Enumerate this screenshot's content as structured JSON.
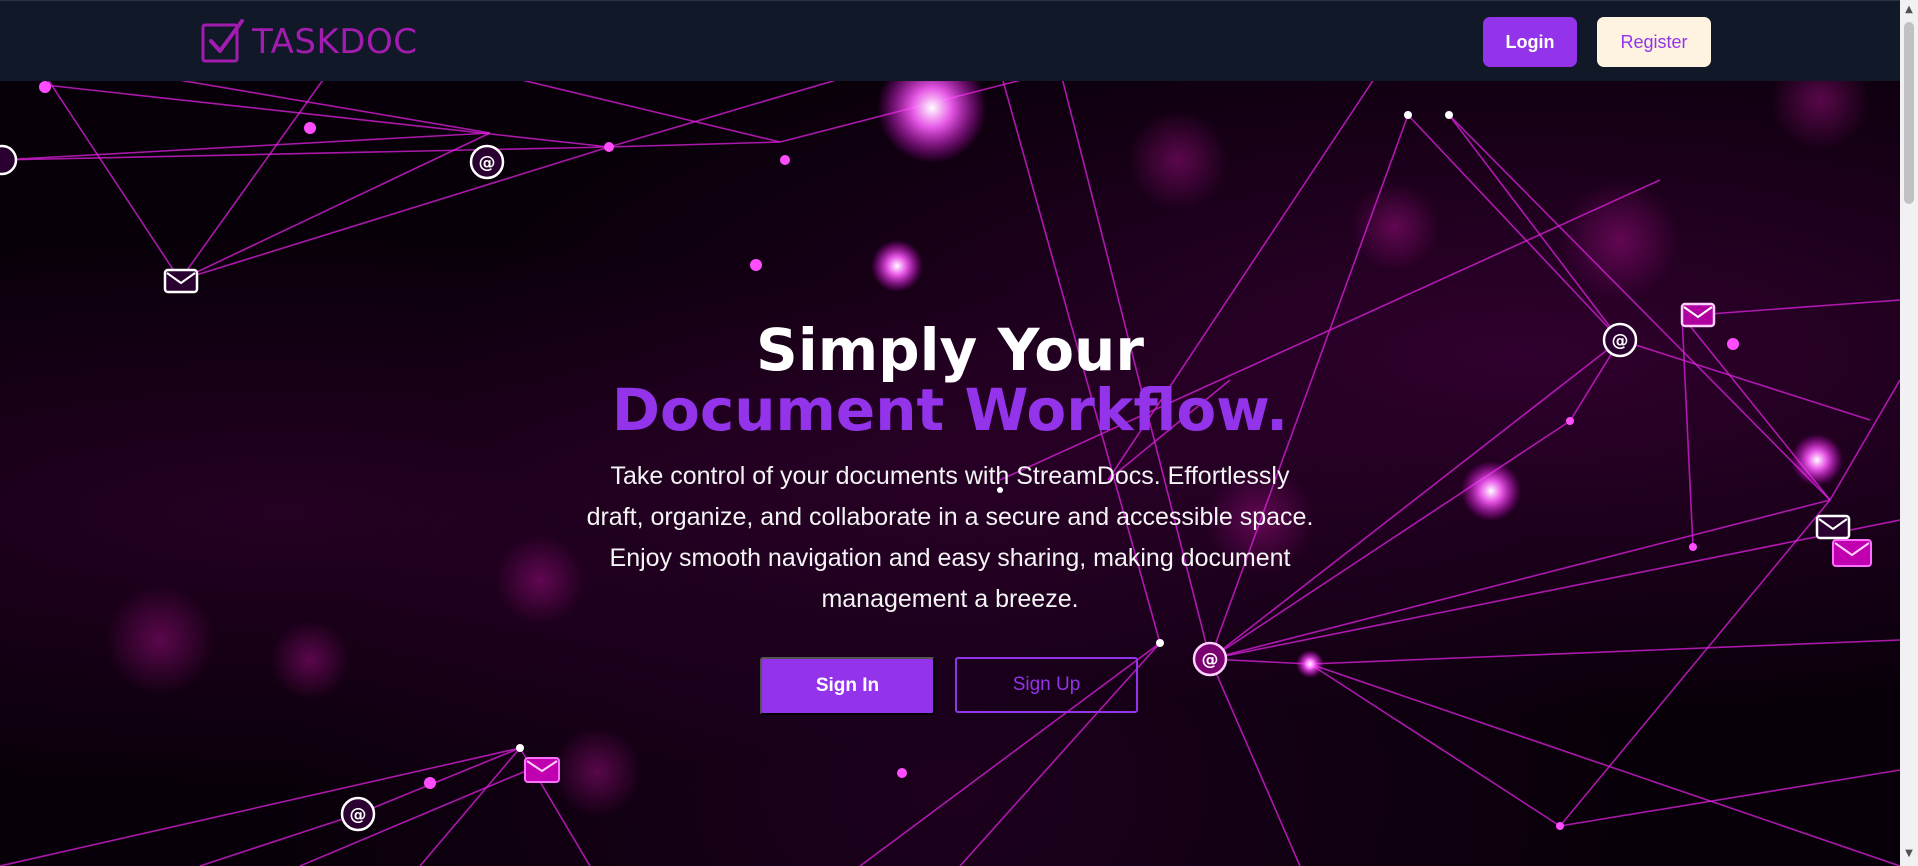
{
  "nav": {
    "brand": "TASKDOC",
    "login_label": "Login",
    "register_label": "Register"
  },
  "hero": {
    "headline_line1": "Simply Your",
    "headline_line2": "Document Workflow.",
    "description": "Take control of your documents with StreamDocs. Effortlessly draft, organize, and collaborate in a secure and accessible space. Enjoy smooth navigation and easy sharing, making document management a breeze.",
    "primary_cta": "Sign In",
    "secondary_cta": "Sign Up"
  },
  "icons": {
    "logo": "checkbox-document-icon",
    "network_nodes": [
      "at-sign-icon",
      "envelope-icon"
    ]
  },
  "colors": {
    "accent": "#9333ea",
    "brand": "#a21caf",
    "nav_bg": "#111827",
    "register_bg": "#fef3e0",
    "network_glow": "#ff33ff"
  }
}
